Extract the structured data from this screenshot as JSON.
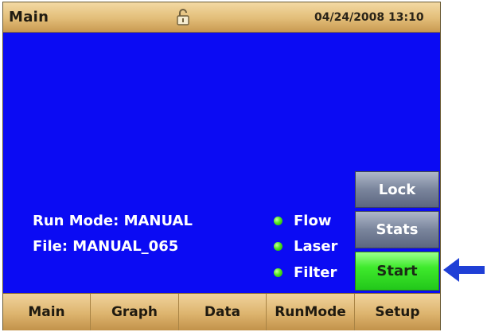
{
  "header": {
    "title": "Main",
    "lock_icon": "unlocked-padlock-icon",
    "datetime": "04/24/2008 13:10"
  },
  "info": {
    "run_mode": "Run Mode: MANUAL",
    "file": "File: MANUAL_065"
  },
  "status": [
    {
      "label": "Flow",
      "indicator_color": "#44e01a"
    },
    {
      "label": "Laser",
      "indicator_color": "#44e01a"
    },
    {
      "label": "Filter",
      "indicator_color": "#44e01a"
    }
  ],
  "side_buttons": {
    "lock": "Lock",
    "stats": "Stats",
    "start": "Start"
  },
  "tabs": [
    {
      "label": "Main"
    },
    {
      "label": "Graph"
    },
    {
      "label": "Data"
    },
    {
      "label": "RunMode"
    },
    {
      "label": "Setup"
    }
  ],
  "colors": {
    "display_background": "#0b0bf3",
    "bar_tan": "#e2bd78",
    "start_green": "#3fea2c",
    "annotation_arrow": "#1f3fd6"
  },
  "annotation": {
    "icon": "left-arrow-icon"
  }
}
